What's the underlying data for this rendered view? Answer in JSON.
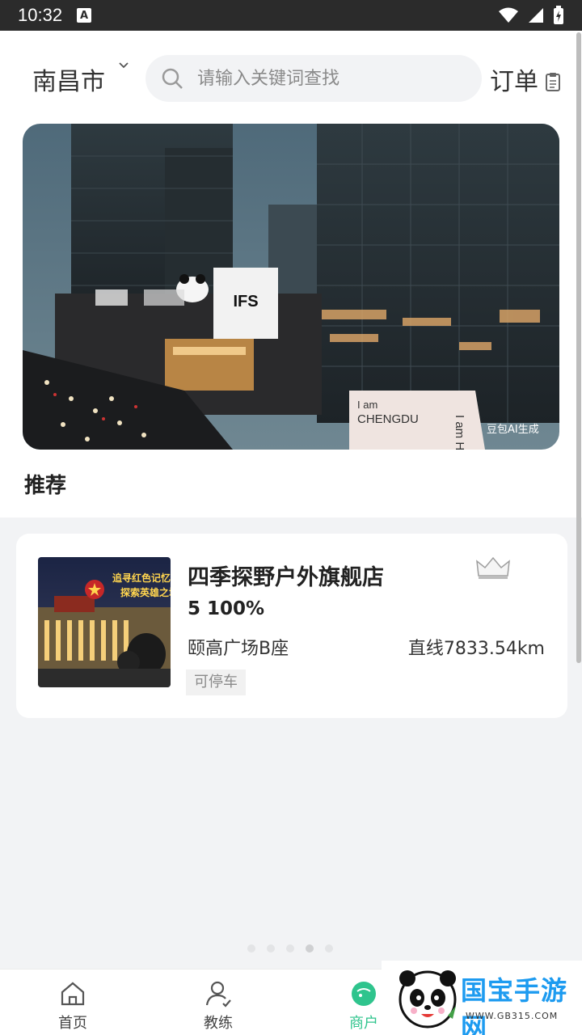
{
  "status_bar": {
    "time": "10:32",
    "notification_icon": "a-badge-icon"
  },
  "header": {
    "city": "南昌市",
    "search_placeholder": "请输入关键词查找",
    "orders_label": "订单"
  },
  "banner": {
    "image": "city-night-skyline-banner",
    "signs": [
      "IFS",
      "I am CHENGDU",
      "I am Here"
    ],
    "credit": "豆包AI生成"
  },
  "section": {
    "title": "推荐"
  },
  "stores": [
    {
      "name": "四季探野户外旗舰店",
      "rating_text": "5 100%",
      "address": "颐高广场B座",
      "distance": "直线7833.54km",
      "tag": "可停车",
      "thumb_caption_1": "追寻红色记忆",
      "thumb_caption_2": "探索英雄之城",
      "badge_icon": "crown-icon"
    }
  ],
  "pager": {
    "count": 5,
    "active_index": 3
  },
  "bottom_nav": {
    "items": [
      {
        "label": "首页",
        "icon": "home-icon"
      },
      {
        "label": "教练",
        "icon": "coach-icon"
      },
      {
        "label": "商户",
        "icon": "merchant-icon"
      }
    ]
  },
  "watermark": {
    "text": "国宝手游网",
    "url": "WWW.GB315.COM"
  },
  "colors": {
    "accent": "#2fc48d",
    "watermark": "#1d9bf0"
  }
}
